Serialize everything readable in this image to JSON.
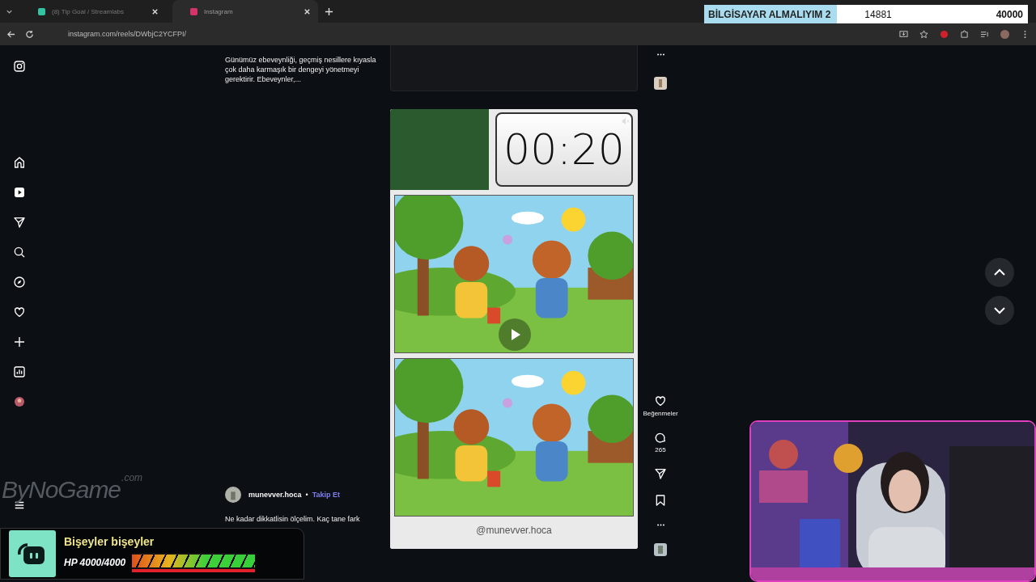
{
  "browser": {
    "tabs": [
      {
        "title": "(8) Tip Goal / Streamlabs",
        "selected": false
      },
      {
        "title": "Instagram",
        "selected": true
      }
    ],
    "address": "instagram.com/reels/DWbjC2YCFPI/"
  },
  "goal": {
    "title": "BİLGİSAYAR ALMALIYIM 2",
    "current": "14881",
    "target": "40000"
  },
  "previous_post": {
    "caption": "Günümüz ebeveynliği, geçmiş nesillere kıyasla çok daha karmaşık bir dengeyi yönetmeyi gerektirir. Ebeveynler,..."
  },
  "reel": {
    "timer": "00:20",
    "handle": "@munevver.hoca"
  },
  "actions": {
    "like_label": "Beğenmeler",
    "comment_count": "265"
  },
  "post": {
    "user": "munevver.hoca",
    "separator": "•",
    "follow": "Takip Et",
    "caption": "Ne kadar dikkatlisin ölçelim. Kaç tane fark"
  },
  "overlay": {
    "logo": "ByNoGame",
    "logo_suffix": ".com",
    "alert_title": "Bişeyler bişeyler",
    "hp": "HP 4000/4000",
    "level": 1
  }
}
